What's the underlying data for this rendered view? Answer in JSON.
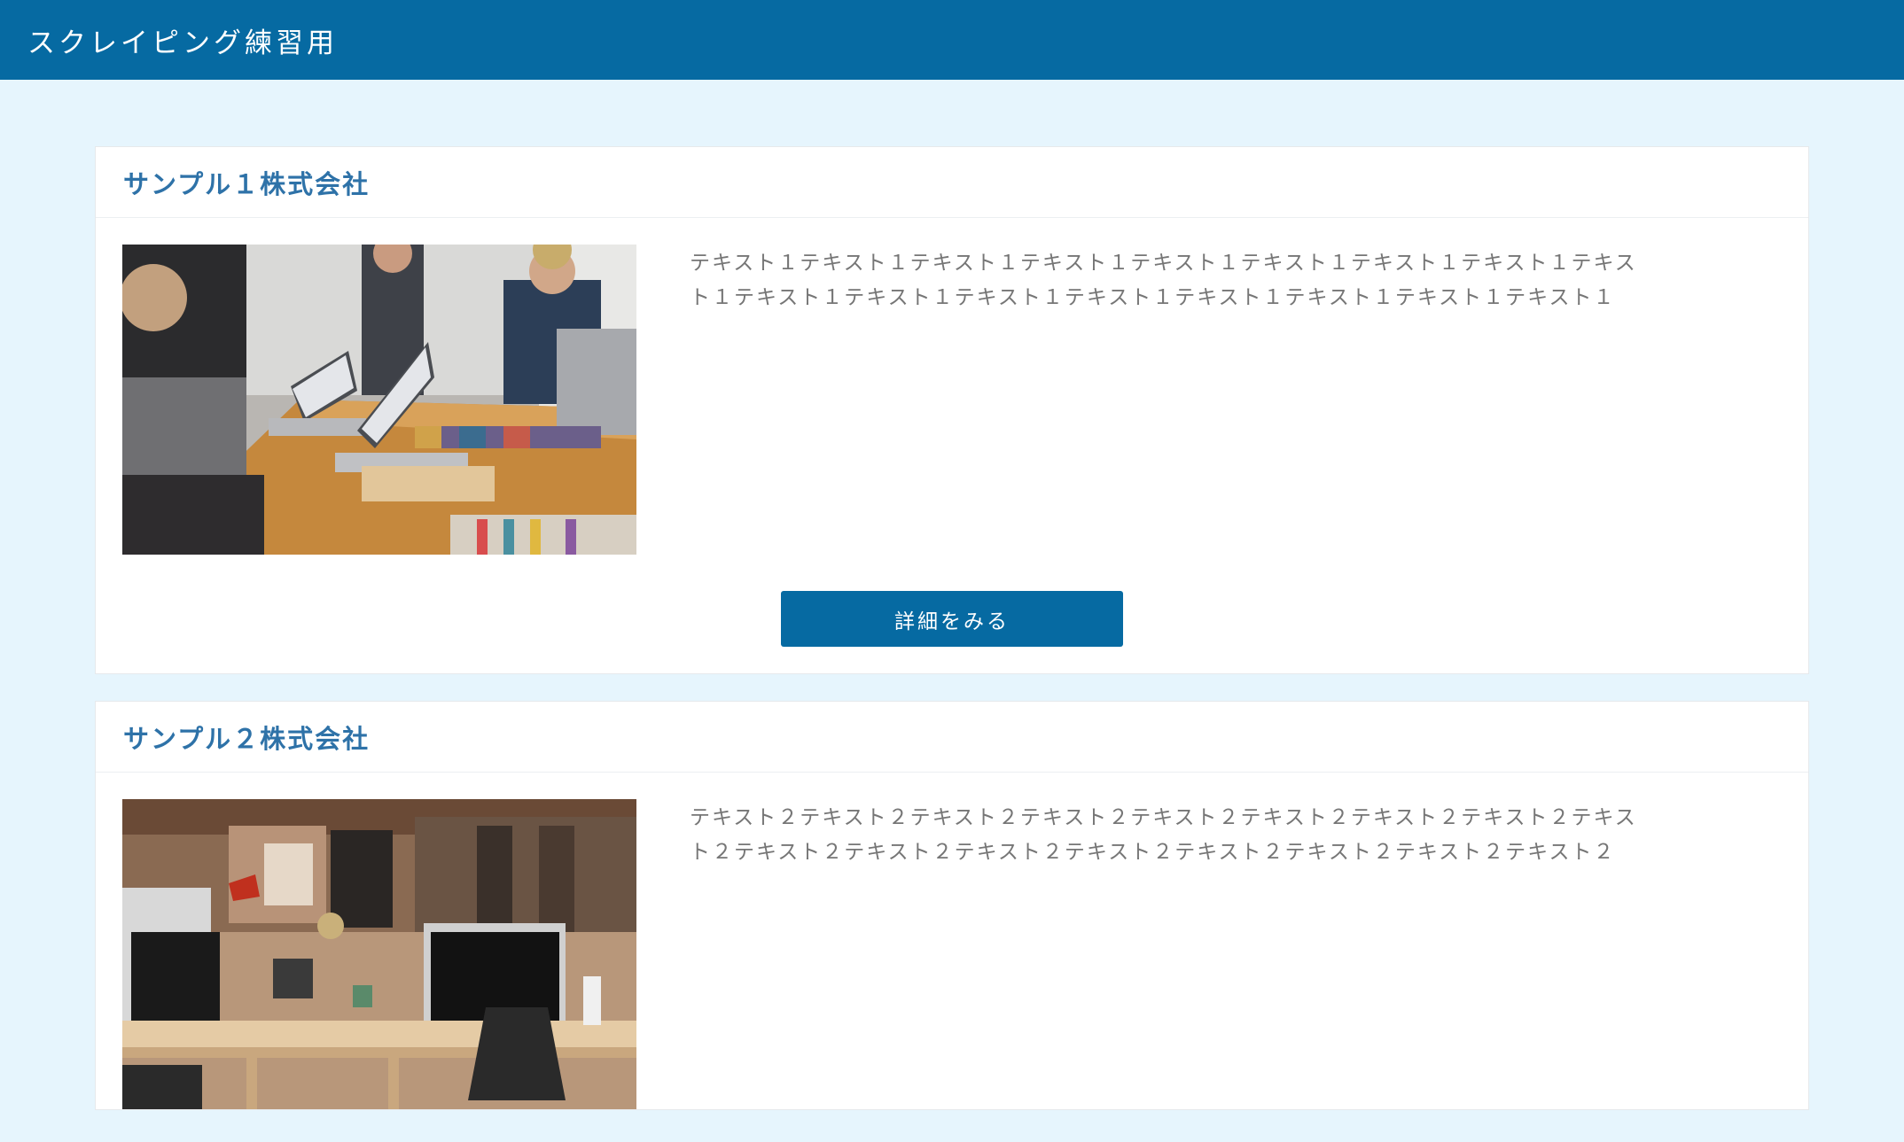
{
  "header": {
    "title": "スクレイピング練習用"
  },
  "cards": [
    {
      "title": "サンプル１株式会社",
      "text": "テキスト１テキスト１テキスト１テキスト１テキスト１テキスト１テキスト１テキスト１テキスト１テキスト１テキスト１テキスト１テキスト１テキスト１テキスト１テキスト１テキスト１",
      "button_label": "詳細をみる",
      "image": "meeting-photo"
    },
    {
      "title": "サンプル２株式会社",
      "text": "テキスト２テキスト２テキスト２テキスト２テキスト２テキスト２テキスト２テキスト２テキスト２テキスト２テキスト２テキスト２テキスト２テキスト２テキスト２テキスト２テキスト２",
      "image": "office-photo"
    }
  ],
  "colors": {
    "header": "#066aa2",
    "page_background": "#e6f5fd",
    "title": "#2e72a8",
    "button": "#066aa2"
  }
}
